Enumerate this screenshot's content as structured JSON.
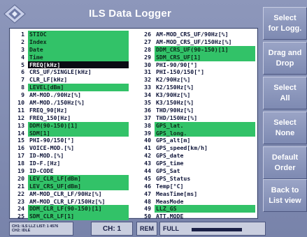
{
  "app": {
    "title": "ILS Data Logger",
    "logo_icon": "diamond-logo-icon"
  },
  "list": {
    "left": [
      {
        "num": "1",
        "label": "STIOC",
        "selected": true
      },
      {
        "num": "2",
        "label": "Index",
        "selected": true
      },
      {
        "num": "3",
        "label": "Date",
        "selected": true
      },
      {
        "num": "4",
        "label": "Time",
        "selected": true
      },
      {
        "num": "5",
        "label": "FREQ[kHz]",
        "current": true
      },
      {
        "num": "6",
        "label": "CRS_UF/SINGLE[kHz]"
      },
      {
        "num": "7",
        "label": "CLR_LF[kHz]"
      },
      {
        "num": "8",
        "label": "LEVEL[dBm]",
        "selected": true
      },
      {
        "num": "9",
        "label": "AM-MOD./90Hz[%]"
      },
      {
        "num": "10",
        "label": "AM-MOD./150Hz[%]"
      },
      {
        "num": "11",
        "label": "FREQ_90[Hz]"
      },
      {
        "num": "12",
        "label": "FREQ_150[Hz]"
      },
      {
        "num": "13",
        "label": "DDM(90-150)[1]",
        "selected": true
      },
      {
        "num": "14",
        "label": "SDM[1]",
        "selected": true
      },
      {
        "num": "15",
        "label": "PHI-90/150[°]"
      },
      {
        "num": "16",
        "label": "VOICE-MOD.[%]"
      },
      {
        "num": "17",
        "label": "ID-MOD.[%]"
      },
      {
        "num": "18",
        "label": "ID-F.[Hz]"
      },
      {
        "num": "19",
        "label": "ID-CODE"
      },
      {
        "num": "20",
        "label": "LEV_CLR_LF[dBm]",
        "selected": true
      },
      {
        "num": "21",
        "label": "LEV_CRS_UF[dBm]",
        "selected": true
      },
      {
        "num": "22",
        "label": "AM-MOD_CLR_LF/90Hz[%]"
      },
      {
        "num": "23",
        "label": "AM-MOD_CLR_LF/150Hz[%]"
      },
      {
        "num": "24",
        "label": "DDM_CLR_LF(90-150)[1]",
        "selected": true
      },
      {
        "num": "25",
        "label": "SDM_CLR_LF[1]",
        "selected": true
      }
    ],
    "right": [
      {
        "num": "26",
        "label": "AM-MOD_CRS_UF/90Hz[%]"
      },
      {
        "num": "27",
        "label": "AM-MOD_CRS_UF/150Hz[%]"
      },
      {
        "num": "28",
        "label": "DDM_CRS_UF(90-150)[1]",
        "selected": true
      },
      {
        "num": "29",
        "label": "SDM_CRS_UF[1]",
        "selected": true
      },
      {
        "num": "30",
        "label": "PHI-90/90[°]"
      },
      {
        "num": "31",
        "label": "PHI-150/150[°]"
      },
      {
        "num": "32",
        "label": "K2/90Hz[%]"
      },
      {
        "num": "33",
        "label": "K2/150Hz[%]"
      },
      {
        "num": "34",
        "label": "K3/90Hz[%]"
      },
      {
        "num": "35",
        "label": "K3/150Hz[%]"
      },
      {
        "num": "36",
        "label": "THD/90Hz[%]"
      },
      {
        "num": "37",
        "label": "THD/150Hz[%]"
      },
      {
        "num": "38",
        "label": "GPS_lat.",
        "selected": true
      },
      {
        "num": "39",
        "label": "GPS_long.",
        "selected": true
      },
      {
        "num": "40",
        "label": "GPS_alt[m]"
      },
      {
        "num": "41",
        "label": "GPS_speed[km/h]"
      },
      {
        "num": "42",
        "label": "GPS_date"
      },
      {
        "num": "43",
        "label": "GPS_time"
      },
      {
        "num": "44",
        "label": "GPS_Sat"
      },
      {
        "num": "45",
        "label": "GPS_Status"
      },
      {
        "num": "46",
        "label": "Temp[°C]"
      },
      {
        "num": "47",
        "label": "MeasTime[ms]"
      },
      {
        "num": "48",
        "label": "MeasMode"
      },
      {
        "num": "49",
        "label": "LLZ_GS",
        "selected": true
      },
      {
        "num": "50",
        "label": "ATT.MODE"
      }
    ]
  },
  "buttons": [
    {
      "name": "select-for-logging-button",
      "label": "Select\nfor Logg."
    },
    {
      "name": "drag-and-drop-button",
      "label": "Drag and\nDrop"
    },
    {
      "name": "select-all-button",
      "label": "Select\nAll"
    },
    {
      "name": "select-none-button",
      "label": "Select\nNone"
    },
    {
      "name": "default-order-button",
      "label": "Default\nOrder"
    },
    {
      "name": "back-to-list-view-button",
      "label": "Back to\nList view"
    }
  ],
  "status": {
    "info_line1": "CH1: ILS LLZ  LIST: 1     4576",
    "info_line2": "CH2:           IDLE",
    "channel": "CH: 1",
    "remote": "REM",
    "full": "FULL",
    "level_fraction": 0.72
  }
}
